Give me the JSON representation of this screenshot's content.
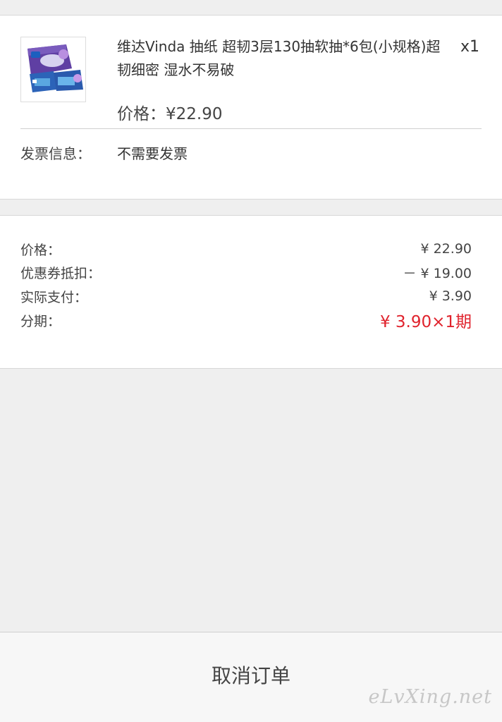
{
  "product": {
    "title": "维达Vinda 抽纸 超韧3层130抽软抽*6包(小规格)超韧细密 湿水不易破",
    "quantity": "x1",
    "price": "价格：¥22.90",
    "thumbnail_icon": "tissue-pack-image"
  },
  "invoice": {
    "label": "发票信息：",
    "value": "不需要发票"
  },
  "summary": [
    {
      "label": "价格：",
      "value": "¥ 22.90"
    },
    {
      "label": "优惠券抵扣：",
      "value": "－ ¥ 19.00"
    },
    {
      "label": "实际支付：",
      "value": "¥ 3.90"
    },
    {
      "label": "分期：",
      "value": "¥ 3.90×1期"
    }
  ],
  "footer": {
    "cancel_label": "取消订单"
  },
  "watermark": "eLvXing.net",
  "colors": {
    "accent_red": "#e0232d",
    "background": "#efefef"
  }
}
